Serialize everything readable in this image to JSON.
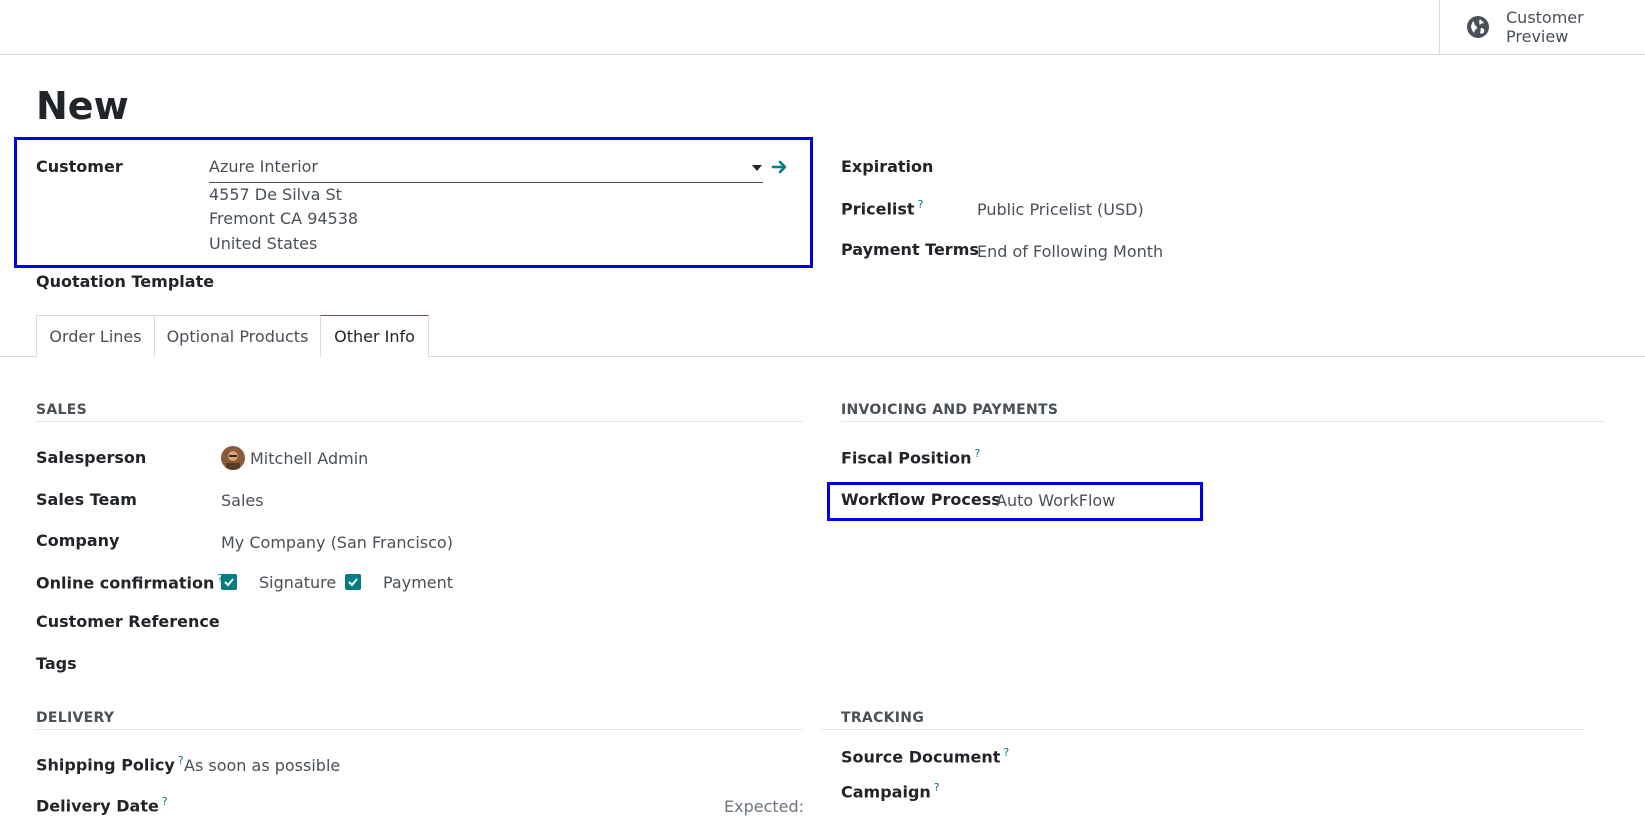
{
  "topbar": {
    "preview_label": "Customer Preview",
    "preview_icon": "globe-icon"
  },
  "title": "New",
  "customer": {
    "label": "Customer",
    "value": "Azure Interior",
    "address_line1": "4557 De Silva St",
    "address_line2": "Fremont CA 94538",
    "address_line3": "United States"
  },
  "right_header": {
    "expiration_label": "Expiration",
    "pricelist_label": "Pricelist",
    "pricelist_value": "Public Pricelist (USD)",
    "payment_terms_label": "Payment Terms",
    "payment_terms_value": "End of Following Month"
  },
  "quotation_template_label": "Quotation Template",
  "tabs": [
    {
      "label": "Order Lines"
    },
    {
      "label": "Optional Products"
    },
    {
      "label": "Other Info"
    }
  ],
  "sales": {
    "section": "SALES",
    "salesperson_label": "Salesperson",
    "salesperson_value": "Mitchell Admin",
    "team_label": "Sales Team",
    "team_value": "Sales",
    "company_label": "Company",
    "company_value": "My Company (San Francisco)",
    "online_label": "Online confirmation",
    "signature_label": "Signature",
    "payment_label": "Payment",
    "customer_ref_label": "Customer Reference",
    "tags_label": "Tags"
  },
  "invoicing": {
    "section": "INVOICING AND PAYMENTS",
    "fiscal_label": "Fiscal Position",
    "workflow_label": "Workflow Process",
    "workflow_value": "Auto WorkFlow"
  },
  "delivery": {
    "section": "DELIVERY",
    "shipping_label": "Shipping Policy",
    "shipping_value": "As soon as possible",
    "delivery_date_label": "Delivery Date",
    "expected_label": "Expected:"
  },
  "tracking": {
    "section": "TRACKING",
    "source_label": "Source Document",
    "campaign_label": "Campaign"
  },
  "help_mark": "?",
  "colors": {
    "accent": "#017e84",
    "highlight": "#0000e6",
    "tab_active": "#714b67"
  }
}
